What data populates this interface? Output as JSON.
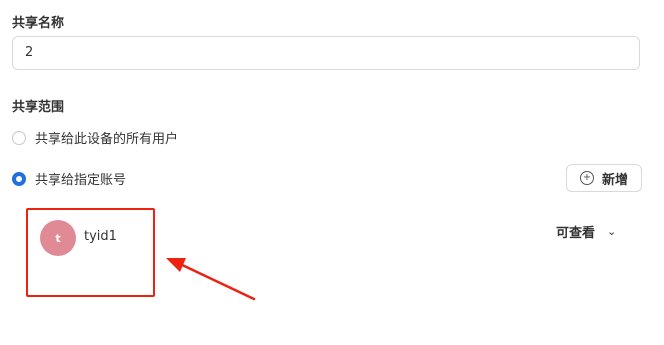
{
  "share_name": {
    "label": "共享名称",
    "value": "2"
  },
  "share_scope": {
    "label": "共享范围",
    "options": [
      {
        "label": "共享给此设备的所有用户",
        "checked": false
      },
      {
        "label": "共享给指定账号",
        "checked": true
      }
    ]
  },
  "add_button": {
    "label": "新增",
    "icon": "plus-circle-icon"
  },
  "accounts": [
    {
      "avatar_letter": "t",
      "avatar_color": "#e08a96",
      "name": "tyid1",
      "permission": "可查看"
    }
  ],
  "annotation": {
    "color": "#ee2211"
  },
  "colors": {
    "accent": "#1f6fe0"
  }
}
